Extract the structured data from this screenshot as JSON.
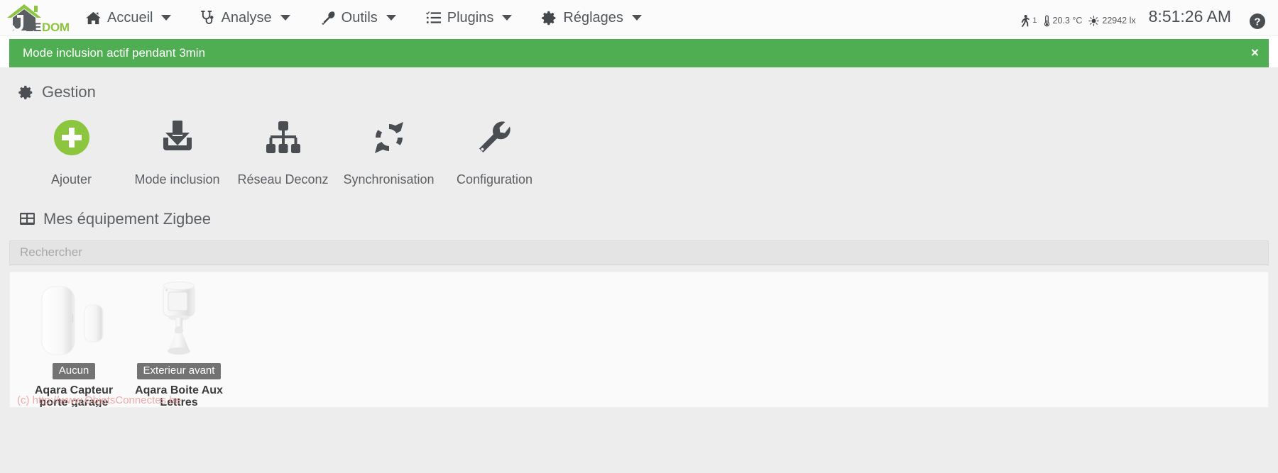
{
  "navbar": {
    "brand": {
      "name": "jeedom-logo",
      "text_dark": "EE",
      "text_green": "DOM"
    },
    "items": [
      {
        "label": "Accueil",
        "icon": "home-icon"
      },
      {
        "label": "Analyse",
        "icon": "stethoscope-icon"
      },
      {
        "label": "Outils",
        "icon": "wrench-icon"
      },
      {
        "label": "Plugins",
        "icon": "list-icon"
      },
      {
        "label": "Réglages",
        "icon": "gear-icon"
      }
    ],
    "sensors": [
      {
        "icon": "motion-walk-icon",
        "value": "1"
      },
      {
        "icon": "thermometer-icon",
        "value": "20.3 °C"
      },
      {
        "icon": "sun-brightness-icon",
        "value": "22942 lx"
      }
    ],
    "clock": "8:51:26 AM",
    "help_icon": "help-circle-icon"
  },
  "alert": {
    "message": "Mode inclusion actif pendant 3min",
    "close_label": "×",
    "color": "#4fad52"
  },
  "gestion": {
    "title": "Gestion",
    "icon": "gear-icon",
    "tiles": [
      {
        "label": "Ajouter",
        "icon": "plus-circle-icon",
        "color": "#8cc63e"
      },
      {
        "label": "Mode inclusion",
        "icon": "download-icon",
        "color": "#4a4e53"
      },
      {
        "label": "Réseau Deconz",
        "icon": "sitemap-icon",
        "color": "#4a4e53"
      },
      {
        "label": "Synchronisation",
        "icon": "refresh-icon",
        "color": "#4a4e53"
      },
      {
        "label": "Configuration",
        "icon": "wrench-icon",
        "color": "#4a4e53"
      }
    ]
  },
  "equipment": {
    "title": "Mes équipement Zigbee",
    "icon": "table-grid-icon",
    "search": {
      "placeholder": "Rechercher",
      "value": ""
    },
    "cards": [
      {
        "badge": "Aucun",
        "name": "Aqara Capteur porte garage",
        "image": "door-window-sensor-image"
      },
      {
        "badge": "Exterieur avant",
        "name": "Aqara Boite Aux Lettres",
        "image": "motion-sensor-image"
      }
    ]
  },
  "watermark": "(c) http://www.ObjetsConnectes.be"
}
